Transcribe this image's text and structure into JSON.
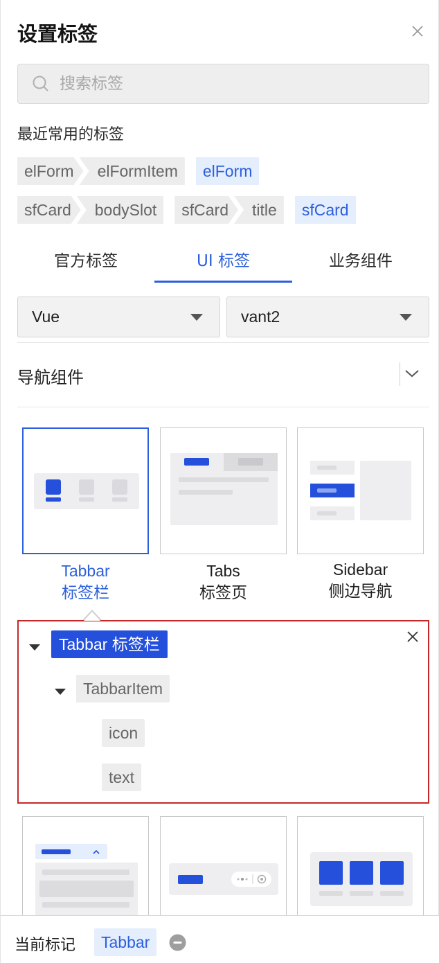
{
  "header": {
    "title": "设置标签"
  },
  "search": {
    "placeholder": "搜索标签",
    "value": ""
  },
  "recent": {
    "title": "最近常用的标签",
    "row1": {
      "path1": [
        "elForm",
        "elFormItem"
      ],
      "single": "elForm"
    },
    "row2": {
      "path1": [
        "sfCard",
        "bodySlot"
      ],
      "path2": [
        "sfCard",
        "title"
      ],
      "single": "sfCard"
    }
  },
  "tabs": [
    {
      "label": "官方标签",
      "active": false
    },
    {
      "label": "UI 标签",
      "active": true
    },
    {
      "label": "业务组件",
      "active": false
    }
  ],
  "selects": {
    "framework": "Vue",
    "library": "vant2"
  },
  "group": {
    "title": "导航组件",
    "expanded": true
  },
  "components": [
    {
      "name": "Tabbar",
      "desc": "标签栏",
      "selected": true
    },
    {
      "name": "Tabs",
      "desc": "标签页",
      "selected": false
    },
    {
      "name": "Sidebar",
      "desc": "侧边导航",
      "selected": false
    }
  ],
  "tree": {
    "root": "Tabbar 标签栏",
    "child": "TabbarItem",
    "leaves": [
      "icon",
      "text"
    ]
  },
  "footer": {
    "label": "当前标记",
    "current": "Tabbar"
  },
  "colors": {
    "accent": "#2c5fdc",
    "highlight_border": "#c62828",
    "chip_bg": "#ededed"
  }
}
